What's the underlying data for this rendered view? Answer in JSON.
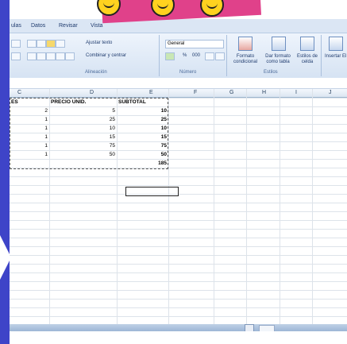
{
  "ribbon_tabs": {
    "formulas": "ulas",
    "data": "Datos",
    "review": "Revisar",
    "view": "Vista"
  },
  "ribbon": {
    "wrap_text": "Ajustar texto",
    "merge_center": "Combinar y centrar",
    "number_format": "General",
    "percent": "%",
    "thousands": "000",
    "conditional_format": "Formato condicional",
    "format_as_table": "Dar formato como tabla",
    "cell_styles": "Estilos de celda",
    "insert": "Insertar El",
    "group_alignment": "Alineación",
    "group_number": "Número",
    "group_styles": "Estilos"
  },
  "columns": [
    "C",
    "D",
    "E",
    "F",
    "G",
    "H",
    "I",
    "J"
  ],
  "table": {
    "headers": [
      "ES",
      "PRECIO UNID.",
      "SUBTOTAL"
    ],
    "rows": [
      {
        "qty": "2",
        "price": "5",
        "subtotal": "10"
      },
      {
        "qty": "1",
        "price": "25",
        "subtotal": "25"
      },
      {
        "qty": "1",
        "price": "10",
        "subtotal": "10"
      },
      {
        "qty": "1",
        "price": "15",
        "subtotal": "15"
      },
      {
        "qty": "1",
        "price": "75",
        "subtotal": "75"
      },
      {
        "qty": "1",
        "price": "50",
        "subtotal": "50"
      }
    ],
    "total": "185"
  },
  "colors": {
    "background": "#3e44c8",
    "overlay_pink": "#e0418a",
    "smiley": "#ffd21f",
    "ribbon": "#dbe6f4"
  }
}
